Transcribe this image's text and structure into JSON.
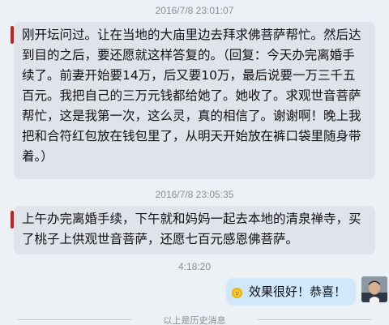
{
  "messages": [
    {
      "timestamp": "2016/7/8 23:01:07",
      "lines": [
        "刚开坛问过。让在当地的大庙里边去拜求佛菩萨帮忙。然后达",
        "到目的之后，要还愿就这样答复的。（回复：今天办完离婚手",
        "续了。前妻开始要14万，后又要10万，最后说要一万三千五",
        "百元。我把自己的三万元钱都给她了。她收了。求观世音菩萨",
        "帮忙，这是我第一次，这么灵，真的相信了。谢谢啊！晚上我",
        "把和合符红包放在钱包里了，从明天开始放在裤口袋里随身带",
        "着。）"
      ]
    },
    {
      "timestamp": "2016/7/8 23:05:35",
      "lines": [
        "上午办完离婚手续，下午就和妈妈一起去本地的清泉禅寺，买",
        "了桃子上供观世音菩萨，还愿七百元感恩佛菩萨。"
      ]
    }
  ],
  "outgoing": {
    "timestamp": "4:18:20",
    "text": "效果很好！恭喜！"
  },
  "history_divider": "以上是历史消息",
  "colors": {
    "background": "#ecf1f6",
    "incoming_bubble": "#dfe4ea",
    "outgoing_bubble": "#cfe8fb",
    "accent_red": "#c62020"
  }
}
